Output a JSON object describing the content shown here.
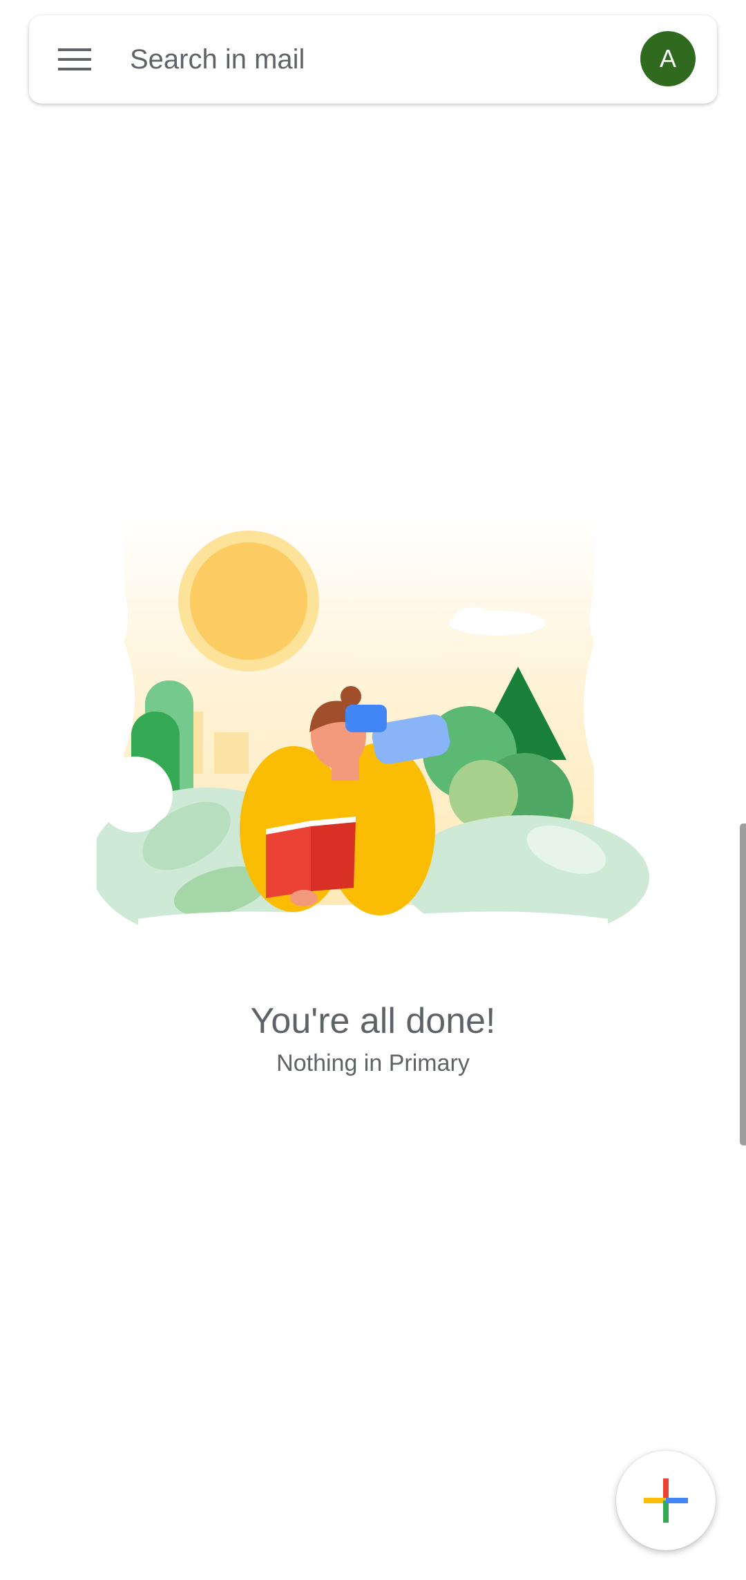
{
  "search": {
    "placeholder": "Search in mail"
  },
  "account": {
    "initial": "A",
    "avatar_color": "#2f6a1f"
  },
  "empty_state": {
    "title": "You're all done!",
    "subtitle": "Nothing in Primary"
  },
  "icons": {
    "menu": "hamburger-menu-icon",
    "compose": "plus-icon"
  },
  "colors": {
    "compose_plus": [
      "#ea4335",
      "#fbbc04",
      "#34a853",
      "#4285f4"
    ],
    "text_secondary": "#5f6368"
  }
}
